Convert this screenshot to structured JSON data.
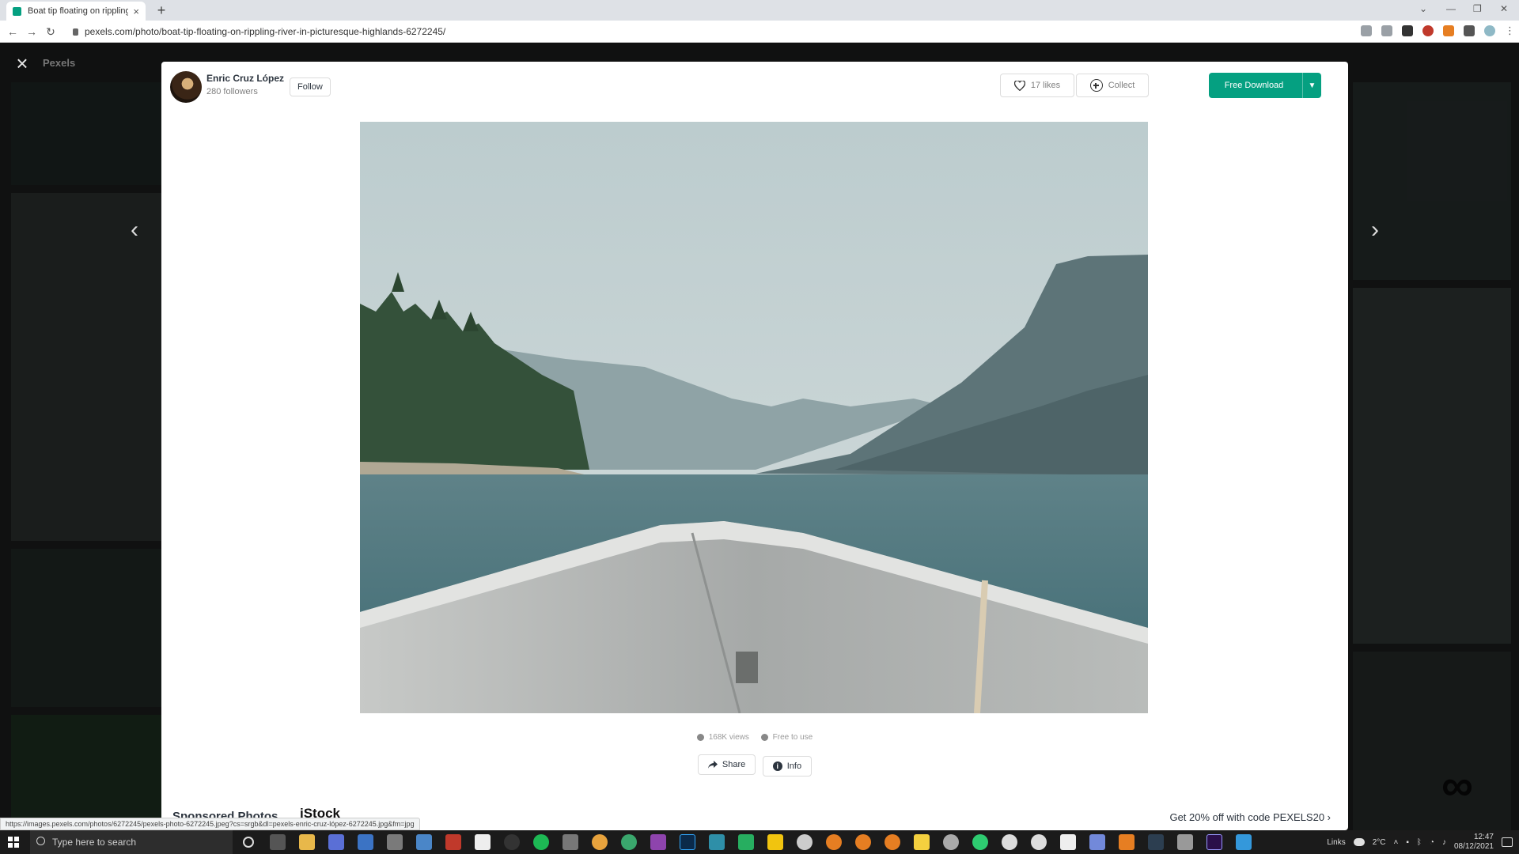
{
  "browser": {
    "tab_title": "Boat tip floating on rippling river",
    "tab_close": "×",
    "new_tab": "+",
    "url": "pexels.com/photo/boat-tip-floating-on-rippling-river-in-picturesque-highlands-6272245/",
    "status_url": "https://images.pexels.com/photos/6272245/pexels-photo-6272245.jpeg?cs=srgb&dl=pexels-enric-cruz-lópez-6272245.jpg&fm=jpg"
  },
  "background": {
    "brand": "Pexels"
  },
  "modal": {
    "close": "×",
    "author": "Enric Cruz López",
    "followers": "280 followers",
    "follow": "Follow",
    "likes": "17 likes",
    "collect": "Collect",
    "download": "Free Download",
    "meta": {
      "views": "168K views",
      "license": "Free to use"
    },
    "share": "Share",
    "info": "Info",
    "sponsored": "Sponsored Photos",
    "istock": "iStock",
    "promo": "Get 20% off with code PEXELS20 ›"
  },
  "taskbar": {
    "search_placeholder": "Type here to search",
    "links": "Links",
    "weather": "2°C",
    "time": "12:47",
    "date": "08/12/2021"
  },
  "colors": {
    "accent": "#05a081"
  }
}
